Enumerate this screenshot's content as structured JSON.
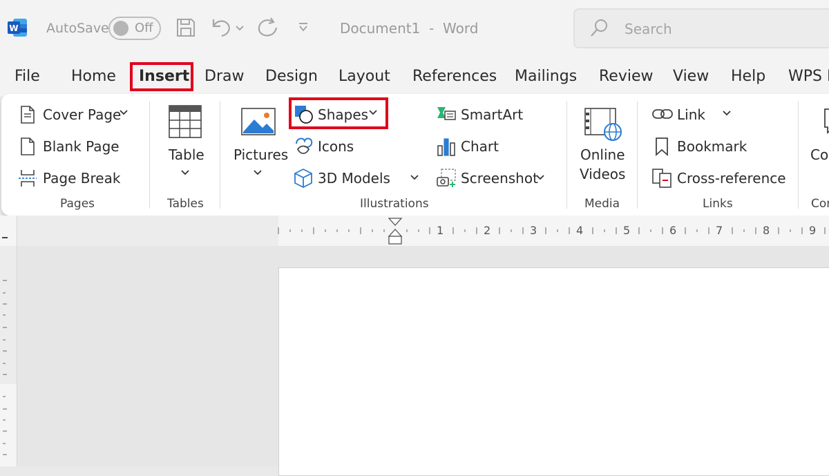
{
  "titlebar": {
    "app_letter": "W",
    "autosave_label": "AutoSave",
    "autosave_state": "Off",
    "document_title": "Document1  -  Word",
    "search_placeholder": "Search",
    "accent": "#2b579a"
  },
  "tabs": [
    {
      "label": "File"
    },
    {
      "label": "Home"
    },
    {
      "label": "Insert",
      "active": true
    },
    {
      "label": "Draw"
    },
    {
      "label": "Design"
    },
    {
      "label": "Layout"
    },
    {
      "label": "References"
    },
    {
      "label": "Mailings"
    },
    {
      "label": "Review"
    },
    {
      "label": "View"
    },
    {
      "label": "Help"
    },
    {
      "label": "WPS PDF"
    }
  ],
  "ribbon": {
    "pages": {
      "cover_page": "Cover Page",
      "blank_page": "Blank Page",
      "page_break": "Page Break",
      "group_label": "Pages"
    },
    "tables": {
      "table": "Table",
      "group_label": "Tables"
    },
    "illustrations": {
      "pictures": "Pictures",
      "shapes": "Shapes",
      "icons": "Icons",
      "models_3d": "3D Models",
      "smartart": "SmartArt",
      "chart": "Chart",
      "screenshot": "Screenshot",
      "group_label": "Illustrations"
    },
    "media": {
      "online": "Online",
      "videos": "Videos",
      "group_label": "Media"
    },
    "links": {
      "link": "Link",
      "bookmark": "Bookmark",
      "cross_reference": "Cross-reference",
      "group_label": "Links"
    },
    "comments": {
      "comment": "Comment",
      "group_label": "Comments"
    }
  },
  "ruler": {
    "numbers": [
      "1",
      "2",
      "3",
      "4",
      "5",
      "6",
      "7",
      "8",
      "9"
    ]
  },
  "highlight_color": "#e0001b"
}
